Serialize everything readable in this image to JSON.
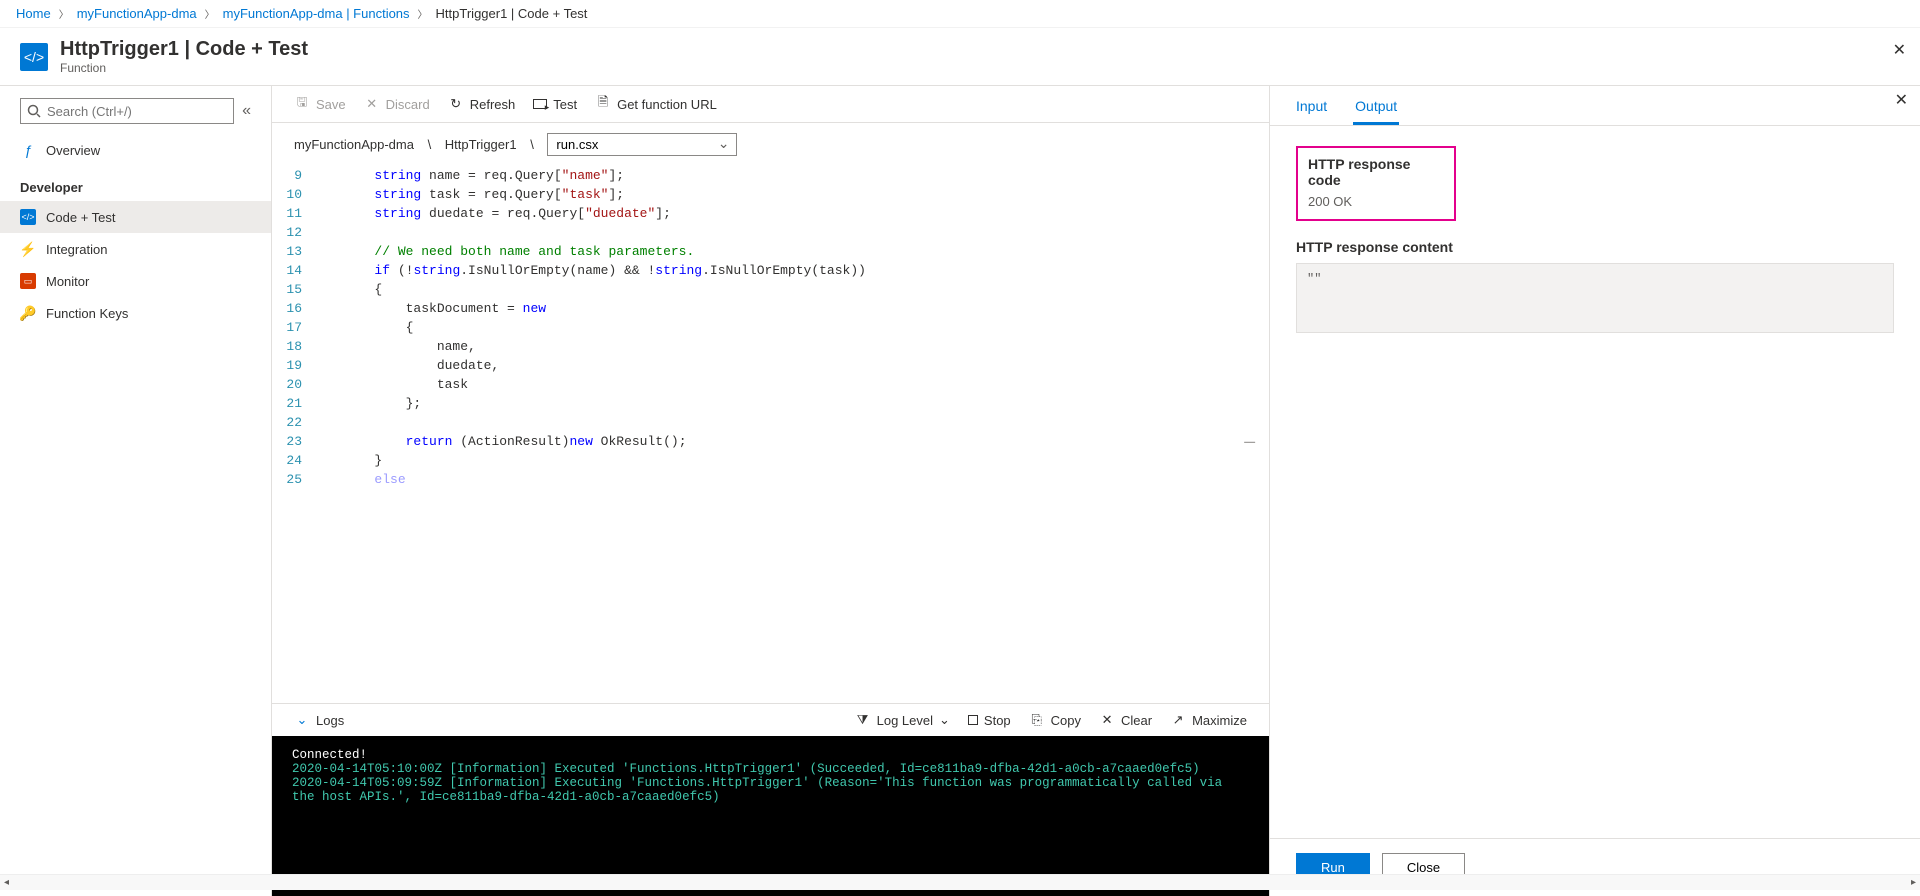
{
  "breadcrumb": {
    "home": "Home",
    "app": "myFunctionApp-dma",
    "functions": "myFunctionApp-dma | Functions",
    "current": "HttpTrigger1 | Code + Test"
  },
  "header": {
    "title": "HttpTrigger1 | Code + Test",
    "subtitle": "Function"
  },
  "sidebar": {
    "search_placeholder": "Search (Ctrl+/)",
    "overview": "Overview",
    "developer_label": "Developer",
    "items": [
      {
        "label": "Code + Test"
      },
      {
        "label": "Integration"
      },
      {
        "label": "Monitor"
      },
      {
        "label": "Function Keys"
      }
    ]
  },
  "toolbar": {
    "save": "Save",
    "discard": "Discard",
    "refresh": "Refresh",
    "test": "Test",
    "get_url": "Get function URL"
  },
  "pathbar": {
    "app": "myFunctionApp-dma",
    "func": "HttpTrigger1",
    "file": "run.csx"
  },
  "code": {
    "lines": [
      {
        "n": 9,
        "html": "<span class='dots'>········</span><span class='tok-kw'>string</span>·name·=·req.Query[<span class='tok-str'>\"name\"</span>];"
      },
      {
        "n": 10,
        "html": "<span class='dots'>········</span><span class='tok-kw'>string</span>·task·=·req.Query[<span class='tok-str'>\"task\"</span>];"
      },
      {
        "n": 11,
        "html": "<span class='dots'>········</span><span class='tok-kw'>string</span>·duedate·=·req.Query[<span class='tok-str'>\"duedate\"</span>];"
      },
      {
        "n": 12,
        "html": ""
      },
      {
        "n": 13,
        "html": "<span class='dots'>········</span><span class='tok-com'>// We need both name and task parameters.</span>"
      },
      {
        "n": 14,
        "html": "<span class='dots'>········</span><span class='tok-kw'>if</span>·(!<span class='tok-kw'>string</span>.IsNullOrEmpty(name)·&amp;&amp;·!<span class='tok-kw'>string</span>.IsNullOrEmpty(task))"
      },
      {
        "n": 15,
        "html": "<span class='dots'>········</span>{"
      },
      {
        "n": 16,
        "html": "<span class='dots'>············</span>taskDocument·=·<span class='tok-kw'>new</span>"
      },
      {
        "n": 17,
        "html": "<span class='dots'>············</span>{"
      },
      {
        "n": 18,
        "html": "<span class='dots'>················</span>name,"
      },
      {
        "n": 19,
        "html": "<span class='dots'>················</span>duedate,"
      },
      {
        "n": 20,
        "html": "<span class='dots'>················</span>task"
      },
      {
        "n": 21,
        "html": "<span class='dots'>············</span>};"
      },
      {
        "n": 22,
        "html": ""
      },
      {
        "n": 23,
        "html": "<span class='dots'>············</span><span class='tok-kw'>return</span>·(ActionResult)<span class='tok-kw'>new</span>·OkResult();"
      },
      {
        "n": 24,
        "html": "<span class='dots'>········</span>}"
      },
      {
        "n": 25,
        "html": "<span class='dots'>········</span><span class='tok-kw' style='opacity:.4'>else</span>"
      }
    ]
  },
  "logsbar": {
    "logs": "Logs",
    "loglevel": "Log Level",
    "stop": "Stop",
    "copy": "Copy",
    "clear": "Clear",
    "maximize": "Maximize"
  },
  "console": {
    "connected": "Connected!",
    "line1": "2020-04-14T05:10:00Z   [Information]   Executed 'Functions.HttpTrigger1' (Succeeded, Id=ce811ba9-dfba-42d1-a0cb-a7caaed0efc5)",
    "line2": "2020-04-14T05:09:59Z   [Information]   Executing 'Functions.HttpTrigger1' (Reason='This function was programmatically called via the host APIs.', Id=ce811ba9-dfba-42d1-a0cb-a7caaed0efc5)"
  },
  "panel": {
    "tab_input": "Input",
    "tab_output": "Output",
    "resp_code_label": "HTTP response code",
    "resp_code_value": "200 OK",
    "resp_content_label": "HTTP response content",
    "resp_content_value": "\"\"",
    "run": "Run",
    "close": "Close"
  }
}
